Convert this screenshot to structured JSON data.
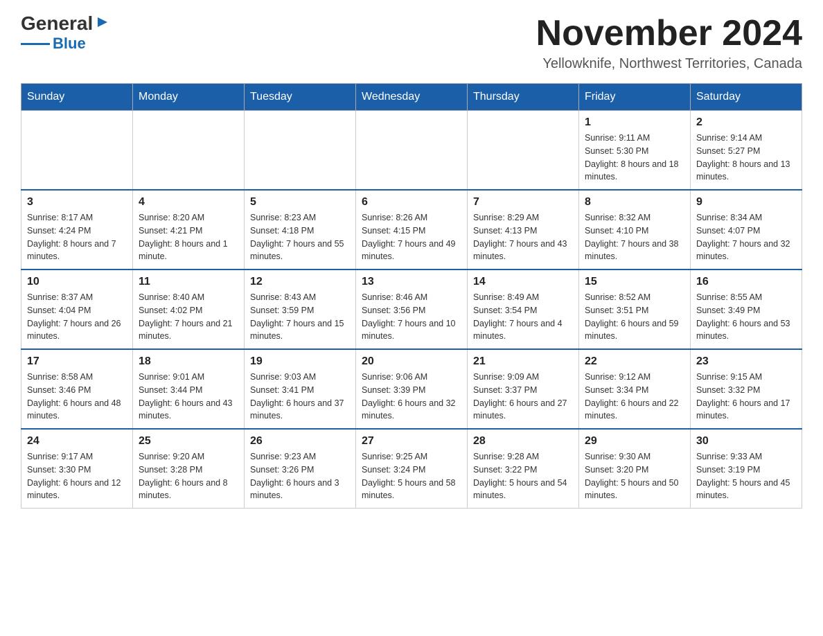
{
  "header": {
    "logo": {
      "general": "General",
      "blue": "Blue"
    },
    "title": "November 2024",
    "location": "Yellowknife, Northwest Territories, Canada"
  },
  "days_of_week": [
    "Sunday",
    "Monday",
    "Tuesday",
    "Wednesday",
    "Thursday",
    "Friday",
    "Saturday"
  ],
  "weeks": [
    [
      {
        "day": "",
        "info": ""
      },
      {
        "day": "",
        "info": ""
      },
      {
        "day": "",
        "info": ""
      },
      {
        "day": "",
        "info": ""
      },
      {
        "day": "",
        "info": ""
      },
      {
        "day": "1",
        "info": "Sunrise: 9:11 AM\nSunset: 5:30 PM\nDaylight: 8 hours and 18 minutes."
      },
      {
        "day": "2",
        "info": "Sunrise: 9:14 AM\nSunset: 5:27 PM\nDaylight: 8 hours and 13 minutes."
      }
    ],
    [
      {
        "day": "3",
        "info": "Sunrise: 8:17 AM\nSunset: 4:24 PM\nDaylight: 8 hours and 7 minutes."
      },
      {
        "day": "4",
        "info": "Sunrise: 8:20 AM\nSunset: 4:21 PM\nDaylight: 8 hours and 1 minute."
      },
      {
        "day": "5",
        "info": "Sunrise: 8:23 AM\nSunset: 4:18 PM\nDaylight: 7 hours and 55 minutes."
      },
      {
        "day": "6",
        "info": "Sunrise: 8:26 AM\nSunset: 4:15 PM\nDaylight: 7 hours and 49 minutes."
      },
      {
        "day": "7",
        "info": "Sunrise: 8:29 AM\nSunset: 4:13 PM\nDaylight: 7 hours and 43 minutes."
      },
      {
        "day": "8",
        "info": "Sunrise: 8:32 AM\nSunset: 4:10 PM\nDaylight: 7 hours and 38 minutes."
      },
      {
        "day": "9",
        "info": "Sunrise: 8:34 AM\nSunset: 4:07 PM\nDaylight: 7 hours and 32 minutes."
      }
    ],
    [
      {
        "day": "10",
        "info": "Sunrise: 8:37 AM\nSunset: 4:04 PM\nDaylight: 7 hours and 26 minutes."
      },
      {
        "day": "11",
        "info": "Sunrise: 8:40 AM\nSunset: 4:02 PM\nDaylight: 7 hours and 21 minutes."
      },
      {
        "day": "12",
        "info": "Sunrise: 8:43 AM\nSunset: 3:59 PM\nDaylight: 7 hours and 15 minutes."
      },
      {
        "day": "13",
        "info": "Sunrise: 8:46 AM\nSunset: 3:56 PM\nDaylight: 7 hours and 10 minutes."
      },
      {
        "day": "14",
        "info": "Sunrise: 8:49 AM\nSunset: 3:54 PM\nDaylight: 7 hours and 4 minutes."
      },
      {
        "day": "15",
        "info": "Sunrise: 8:52 AM\nSunset: 3:51 PM\nDaylight: 6 hours and 59 minutes."
      },
      {
        "day": "16",
        "info": "Sunrise: 8:55 AM\nSunset: 3:49 PM\nDaylight: 6 hours and 53 minutes."
      }
    ],
    [
      {
        "day": "17",
        "info": "Sunrise: 8:58 AM\nSunset: 3:46 PM\nDaylight: 6 hours and 48 minutes."
      },
      {
        "day": "18",
        "info": "Sunrise: 9:01 AM\nSunset: 3:44 PM\nDaylight: 6 hours and 43 minutes."
      },
      {
        "day": "19",
        "info": "Sunrise: 9:03 AM\nSunset: 3:41 PM\nDaylight: 6 hours and 37 minutes."
      },
      {
        "day": "20",
        "info": "Sunrise: 9:06 AM\nSunset: 3:39 PM\nDaylight: 6 hours and 32 minutes."
      },
      {
        "day": "21",
        "info": "Sunrise: 9:09 AM\nSunset: 3:37 PM\nDaylight: 6 hours and 27 minutes."
      },
      {
        "day": "22",
        "info": "Sunrise: 9:12 AM\nSunset: 3:34 PM\nDaylight: 6 hours and 22 minutes."
      },
      {
        "day": "23",
        "info": "Sunrise: 9:15 AM\nSunset: 3:32 PM\nDaylight: 6 hours and 17 minutes."
      }
    ],
    [
      {
        "day": "24",
        "info": "Sunrise: 9:17 AM\nSunset: 3:30 PM\nDaylight: 6 hours and 12 minutes."
      },
      {
        "day": "25",
        "info": "Sunrise: 9:20 AM\nSunset: 3:28 PM\nDaylight: 6 hours and 8 minutes."
      },
      {
        "day": "26",
        "info": "Sunrise: 9:23 AM\nSunset: 3:26 PM\nDaylight: 6 hours and 3 minutes."
      },
      {
        "day": "27",
        "info": "Sunrise: 9:25 AM\nSunset: 3:24 PM\nDaylight: 5 hours and 58 minutes."
      },
      {
        "day": "28",
        "info": "Sunrise: 9:28 AM\nSunset: 3:22 PM\nDaylight: 5 hours and 54 minutes."
      },
      {
        "day": "29",
        "info": "Sunrise: 9:30 AM\nSunset: 3:20 PM\nDaylight: 5 hours and 50 minutes."
      },
      {
        "day": "30",
        "info": "Sunrise: 9:33 AM\nSunset: 3:19 PM\nDaylight: 5 hours and 45 minutes."
      }
    ]
  ]
}
